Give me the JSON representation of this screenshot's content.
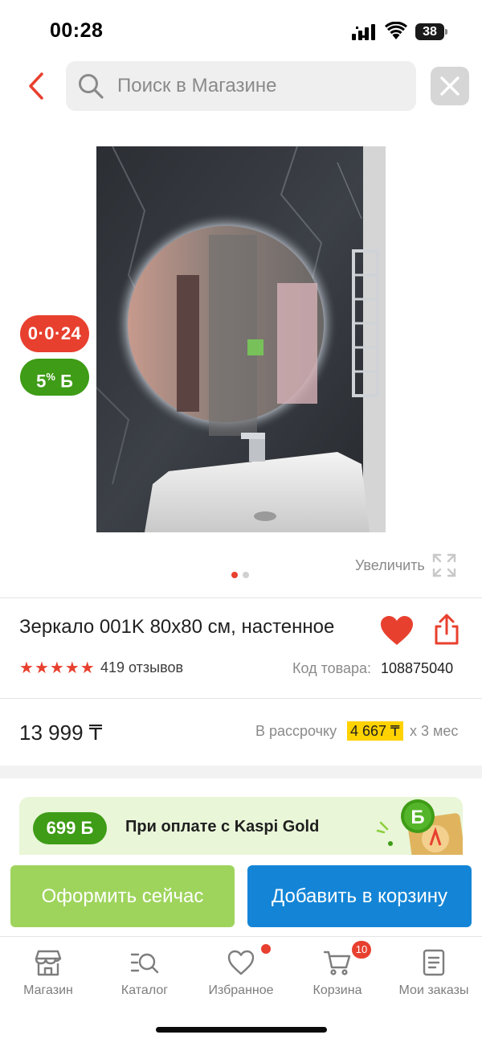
{
  "status_bar": {
    "time": "00:28",
    "battery": "38"
  },
  "search": {
    "placeholder": "Поиск в Магазине"
  },
  "product": {
    "badges": {
      "timer": "0·0·24",
      "bonus_percent": "5",
      "bonus_symbol": "%",
      "bonus_currency": "Б"
    },
    "zoom_label": "Увеличить",
    "image_count": 2,
    "active_image": 1,
    "title": "Зеркало 001K 80x80 см, настенное",
    "rating": 5,
    "reviews": "419 отзывов",
    "sku_label": "Код товара:",
    "sku_value": "108875040",
    "is_favorite": true
  },
  "price": {
    "value": "13 999 ₸",
    "installment_label": "В рассрочку",
    "installment_amount": "4 667 ₸",
    "installment_term": "х 3 мес"
  },
  "kaspi_gold": {
    "bonus": "699 Б",
    "text": "При оплате с Kaspi Gold"
  },
  "actions": {
    "buy_now": "Оформить сейчас",
    "add_to_cart": "Добавить в корзину"
  },
  "tabs": [
    {
      "label": "Магазин",
      "icon": "store-icon"
    },
    {
      "label": "Каталог",
      "icon": "catalog-search-icon"
    },
    {
      "label": "Избранное",
      "icon": "heart-icon"
    },
    {
      "label": "Корзина",
      "icon": "cart-icon"
    },
    {
      "label": "Мои заказы",
      "icon": "orders-icon"
    }
  ],
  "cart_count": "10",
  "colors": {
    "accent_red": "#e8402f",
    "kaspi_green": "#3e9c16",
    "buy_green": "#9ed45c",
    "cart_blue": "#1485d6",
    "installment_yellow": "#ffd200"
  }
}
